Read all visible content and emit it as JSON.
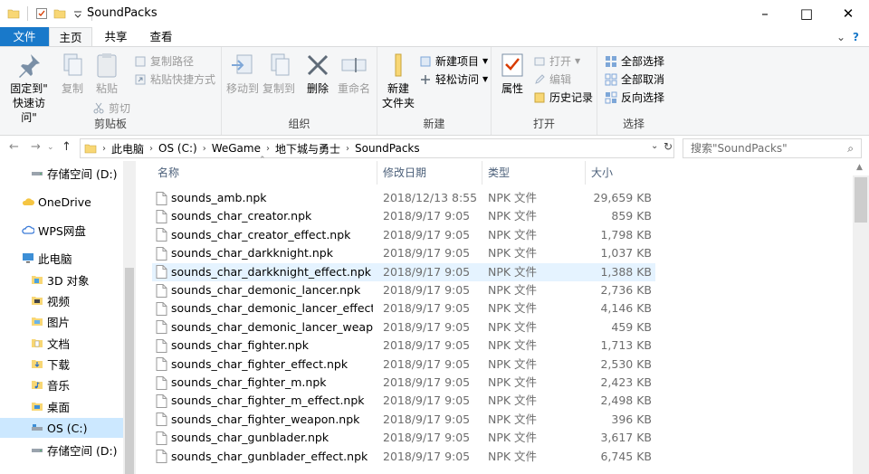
{
  "window": {
    "title": "SoundPacks",
    "minimize": "–",
    "maximize": "□",
    "close": "✕"
  },
  "tabs": {
    "file": "文件",
    "home": "主页",
    "share": "共享",
    "view": "查看",
    "collapse": "⌄",
    "help": "?"
  },
  "ribbon": {
    "clipboard": {
      "label": "剪贴板",
      "pin": "固定到\"\n快速访问\"",
      "pin_l1": "固定到\"",
      "pin_l2": "快速访问\"",
      "copy": "复制",
      "paste": "粘贴",
      "copy_path": "复制路径",
      "paste_shortcut": "粘贴快捷方式",
      "cut": "剪切"
    },
    "organize": {
      "label": "组织",
      "move_to": "移动到",
      "copy_to": "复制到",
      "delete": "删除",
      "rename": "重命名"
    },
    "new": {
      "label": "新建",
      "new_folder_l1": "新建",
      "new_folder_l2": "文件夹",
      "new_item": "新建项目",
      "easy_access": "轻松访问"
    },
    "open": {
      "label": "打开",
      "properties": "属性",
      "open": "打开",
      "edit": "编辑",
      "history": "历史记录"
    },
    "select": {
      "label": "选择",
      "select_all": "全部选择",
      "select_none": "全部取消",
      "invert": "反向选择"
    }
  },
  "address": {
    "back": "←",
    "forward": "→",
    "up": "↑",
    "crumbs": [
      "此电脑",
      "OS (C:)",
      "WeGame",
      "地下城与勇士",
      "SoundPacks"
    ],
    "search_placeholder": "搜索\"SoundPacks\""
  },
  "nav": {
    "items": [
      {
        "label": "存储空间 (D:)",
        "icon": "drive-icon"
      },
      {
        "label": "OneDrive",
        "icon": "cloud-icon"
      },
      {
        "label": "WPS网盘",
        "icon": "cloud-icon"
      },
      {
        "label": "此电脑",
        "icon": "computer-icon"
      },
      {
        "label": "3D 对象",
        "icon": "folder-icon"
      },
      {
        "label": "视频",
        "icon": "folder-icon"
      },
      {
        "label": "图片",
        "icon": "folder-icon"
      },
      {
        "label": "文档",
        "icon": "folder-icon"
      },
      {
        "label": "下载",
        "icon": "folder-icon"
      },
      {
        "label": "音乐",
        "icon": "folder-icon"
      },
      {
        "label": "桌面",
        "icon": "folder-icon"
      },
      {
        "label": "OS (C:)",
        "icon": "drive-icon"
      },
      {
        "label": "存储空间 (D:)",
        "icon": "drive-icon"
      }
    ]
  },
  "columns": {
    "name": "名称",
    "date": "修改日期",
    "type": "类型",
    "size": "大小"
  },
  "files": [
    {
      "name": "sounds_amb.npk",
      "date": "2018/12/13 8:55",
      "type": "NPK 文件",
      "size": "29,659 KB"
    },
    {
      "name": "sounds_char_creator.npk",
      "date": "2018/9/17 9:05",
      "type": "NPK 文件",
      "size": "859 KB"
    },
    {
      "name": "sounds_char_creator_effect.npk",
      "date": "2018/9/17 9:05",
      "type": "NPK 文件",
      "size": "1,798 KB"
    },
    {
      "name": "sounds_char_darkknight.npk",
      "date": "2018/9/17 9:05",
      "type": "NPK 文件",
      "size": "1,037 KB"
    },
    {
      "name": "sounds_char_darkknight_effect.npk",
      "date": "2018/9/17 9:05",
      "type": "NPK 文件",
      "size": "1,388 KB"
    },
    {
      "name": "sounds_char_demonic_lancer.npk",
      "date": "2018/9/17 9:05",
      "type": "NPK 文件",
      "size": "2,736 KB"
    },
    {
      "name": "sounds_char_demonic_lancer_effect....",
      "date": "2018/9/17 9:05",
      "type": "NPK 文件",
      "size": "4,146 KB"
    },
    {
      "name": "sounds_char_demonic_lancer_weap...",
      "date": "2018/9/17 9:05",
      "type": "NPK 文件",
      "size": "459 KB"
    },
    {
      "name": "sounds_char_fighter.npk",
      "date": "2018/9/17 9:05",
      "type": "NPK 文件",
      "size": "1,713 KB"
    },
    {
      "name": "sounds_char_fighter_effect.npk",
      "date": "2018/9/17 9:05",
      "type": "NPK 文件",
      "size": "2,530 KB"
    },
    {
      "name": "sounds_char_fighter_m.npk",
      "date": "2018/9/17 9:05",
      "type": "NPK 文件",
      "size": "2,423 KB"
    },
    {
      "name": "sounds_char_fighter_m_effect.npk",
      "date": "2018/9/17 9:05",
      "type": "NPK 文件",
      "size": "2,498 KB"
    },
    {
      "name": "sounds_char_fighter_weapon.npk",
      "date": "2018/9/17 9:05",
      "type": "NPK 文件",
      "size": "396 KB"
    },
    {
      "name": "sounds_char_gunblader.npk",
      "date": "2018/9/17 9:05",
      "type": "NPK 文件",
      "size": "3,617 KB"
    },
    {
      "name": "sounds_char_gunblader_effect.npk",
      "date": "2018/9/17 9:05",
      "type": "NPK 文件",
      "size": "6,745 KB"
    }
  ],
  "colors": {
    "accent": "#1979ca",
    "selected": "#cce8ff",
    "hover": "#e5f3ff",
    "folder": "#f8d775"
  }
}
